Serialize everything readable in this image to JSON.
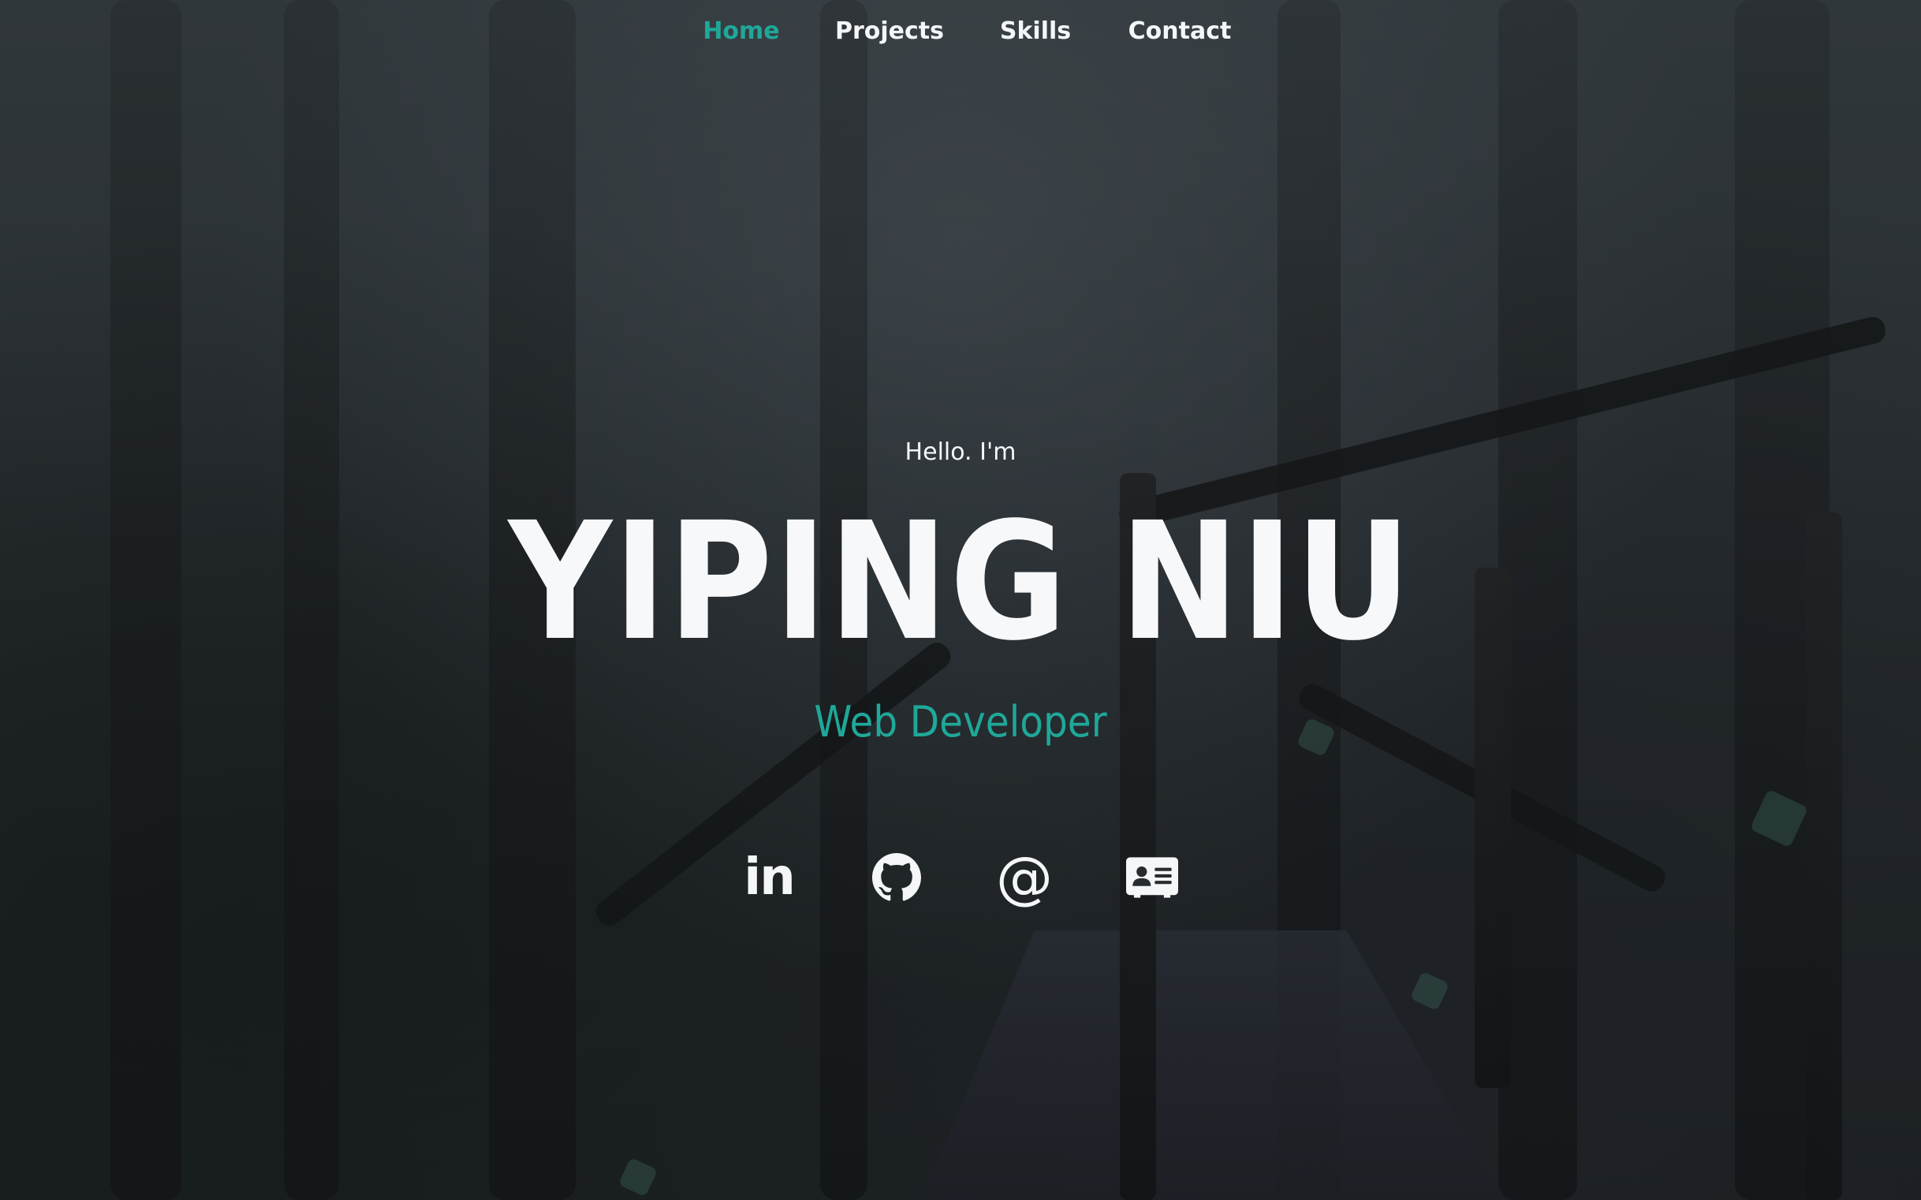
{
  "nav": {
    "items": [
      {
        "label": "Home",
        "active": true
      },
      {
        "label": "Projects",
        "active": false
      },
      {
        "label": "Skills",
        "active": false
      },
      {
        "label": "Contact",
        "active": false
      }
    ]
  },
  "hero": {
    "greeting": "Hello. I'm",
    "name": "YIPING NIU",
    "role": "Web Developer"
  },
  "socials": [
    {
      "icon": "linkedin-icon",
      "glyph": "in"
    },
    {
      "icon": "github-icon"
    },
    {
      "icon": "at-icon",
      "glyph": "@"
    },
    {
      "icon": "contact-card-icon"
    }
  ],
  "colors": {
    "accent": "#1fa899",
    "text": "#f4f6f8",
    "background": "#262c30"
  }
}
